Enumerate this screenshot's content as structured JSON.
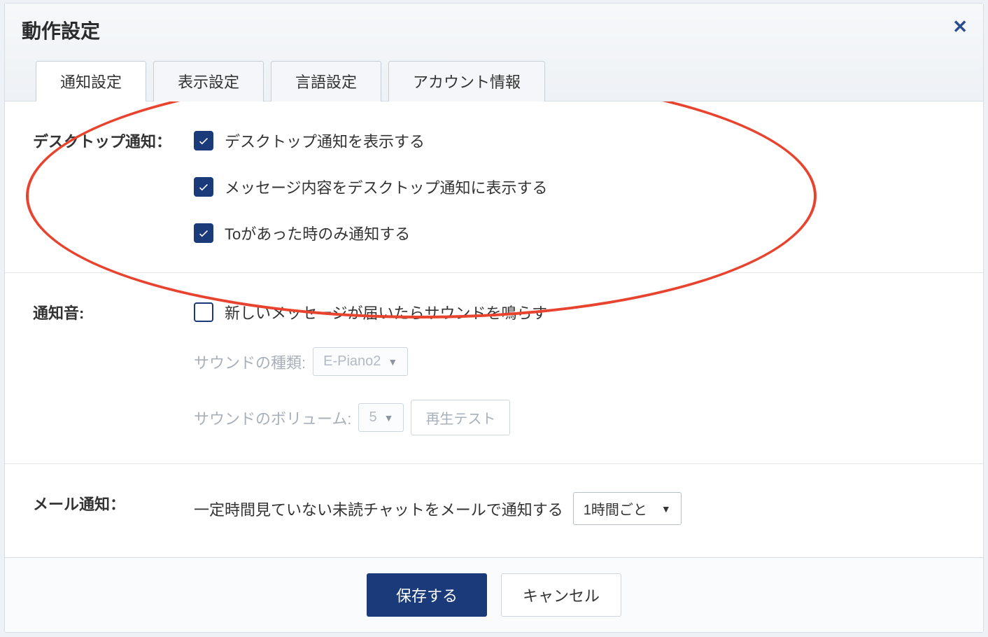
{
  "dialog": {
    "title": "動作設定"
  },
  "tabs": {
    "items": [
      {
        "label": "通知設定",
        "active": true
      },
      {
        "label": "表示設定",
        "active": false
      },
      {
        "label": "言語設定",
        "active": false
      },
      {
        "label": "アカウント情報",
        "active": false
      }
    ]
  },
  "desktop_notify": {
    "label": "デスクトップ通知：",
    "options": [
      {
        "label": "デスクトップ通知を表示する",
        "checked": true
      },
      {
        "label": "メッセージ内容をデスクトップ通知に表示する",
        "checked": true
      },
      {
        "label": "Toがあった時のみ通知する",
        "checked": true
      }
    ]
  },
  "sound": {
    "label": "通知音:",
    "enable": {
      "label": "新しいメッセージが届いたらサウンドを鳴らす",
      "checked": false
    },
    "type_label": "サウンドの種類:",
    "type_value": "E-Piano2",
    "volume_label": "サウンドのボリューム:",
    "volume_value": "5",
    "test_button": "再生テスト"
  },
  "email": {
    "label": "メール通知：",
    "text": "一定時間見ていない未読チャットをメールで通知する",
    "interval_value": "1時間ごと"
  },
  "footer": {
    "save": "保存する",
    "cancel": "キャンセル"
  }
}
